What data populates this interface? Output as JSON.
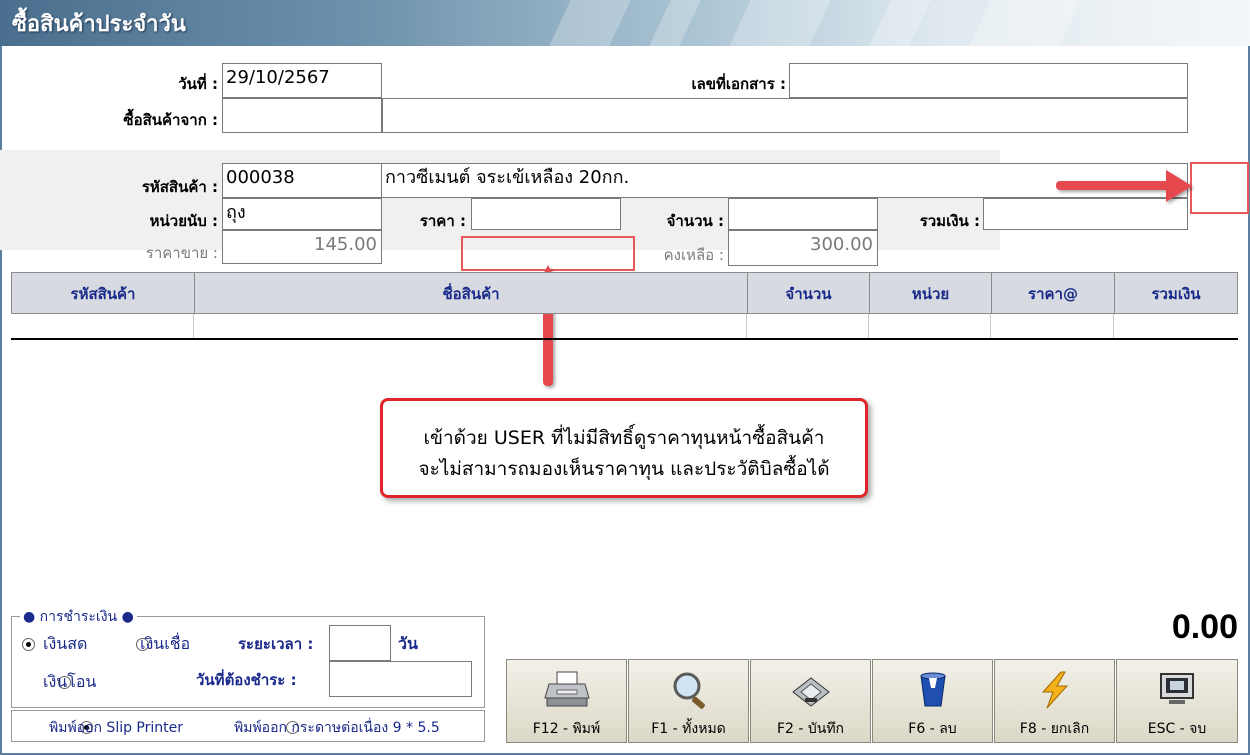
{
  "window": {
    "title": "ซื้อสินค้าประจำวัน"
  },
  "header": {
    "date_label": "วันที่ :",
    "date_value": "29/10/2567",
    "docno_label": "เลขที่เอกสาร :",
    "docno_value": "",
    "supplier_label": "ซื้อสินค้าจาก :",
    "supplier_code": "",
    "supplier_name": ""
  },
  "item": {
    "code_label": "รหัสสินค้า :",
    "code_value": "000038",
    "name_value": "กาวซีเมนต์ จระเข้เหลือง 20กก.",
    "unit_label": "หน่วยนับ :",
    "unit_value": "ถุง",
    "price_label": "ราคา :",
    "price_value": "",
    "qty_label": "จำนวน :",
    "qty_value": "",
    "total_label": "รวมเงิน :",
    "total_value": "",
    "sell_label": "ราคาขาย :",
    "sell_value": "145.00",
    "remain_label": "คงเหลือ :",
    "remain_value": "300.00"
  },
  "grid": {
    "columns": [
      "รหัสสินค้า",
      "ชื่อสินค้า",
      "จำนวน",
      "หน่วย",
      "ราคา@",
      "รวมเงิน"
    ]
  },
  "callout": {
    "line1": "เข้าด้วย USER ที่ไม่มีสิทธิ์ดูราคาทุนหน้าซื้อสินค้า",
    "line2": "จะไม่สามารถมองเห็นราคาทุน และประวัติบิลซื้อได้",
    "color": "#e0262c"
  },
  "payment": {
    "legend": "● การชำระเงิน ●",
    "cash": "เงินสด",
    "credit": "เงินเชื่อ",
    "transfer": "เงินโอน",
    "period_label": "ระยะเวลา :",
    "period_value": "",
    "period_unit": "วัน",
    "due_label": "วันที่ต้องชำระ :",
    "due_value": "",
    "selected": "cash"
  },
  "print": {
    "slip": "พิมพ์ออก Slip Printer",
    "continuous": "พิมพ์ออก กระดาษต่อเนื่อง 9 * 5.5",
    "selected": "slip"
  },
  "grand_total": "0.00",
  "buttons": [
    {
      "label": "F12 - พิมพ์",
      "icon": "printer-icon"
    },
    {
      "label": "F1 - ทั้งหมด",
      "icon": "magnifier-icon"
    },
    {
      "label": "F2 - บันทึก",
      "icon": "disk-icon"
    },
    {
      "label": "F6 - ลบ",
      "icon": "trash-icon"
    },
    {
      "label": "F8 - ยกเลิก",
      "icon": "lightning-icon"
    },
    {
      "label": "ESC - จบ",
      "icon": "monitor-icon"
    }
  ]
}
